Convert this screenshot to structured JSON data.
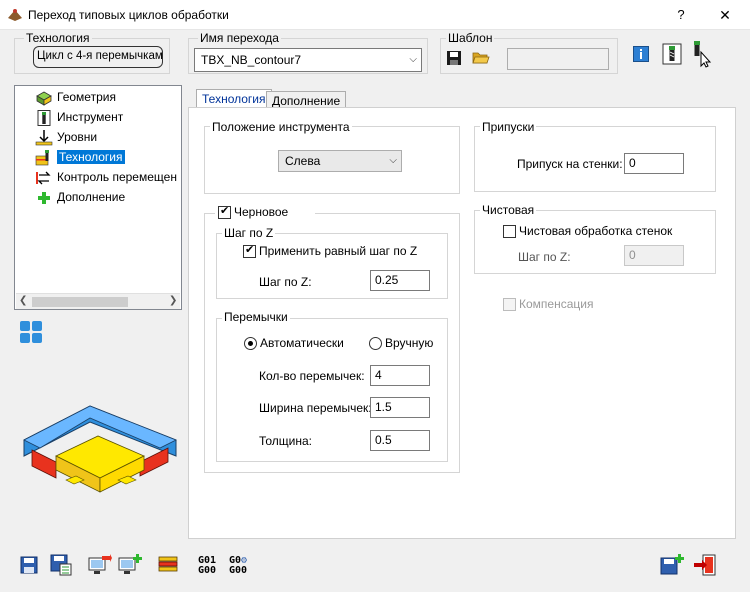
{
  "window": {
    "title": "Переход типовых циклов обработки",
    "help_label": "?",
    "close_label": "✕"
  },
  "header": {
    "technology_label": "Технология",
    "technology_value": "Цикл с 4-я перемычками",
    "transition_name_label": "Имя перехода",
    "transition_name_value": "TBX_NB_contour7",
    "template_label": "Шаблон",
    "template_value": ""
  },
  "tree": {
    "items": [
      {
        "label": "Геометрия",
        "icon": "geometry-icon"
      },
      {
        "label": "Инструмент",
        "icon": "tool-icon"
      },
      {
        "label": "Уровни",
        "icon": "levels-icon"
      },
      {
        "label": "Технология",
        "icon": "technology-icon",
        "selected": true
      },
      {
        "label": "Контроль перемещен",
        "icon": "motion-control-icon"
      },
      {
        "label": "Дополнение",
        "icon": "addition-icon"
      }
    ]
  },
  "tabs": [
    {
      "label": "Технология",
      "active": true
    },
    {
      "label": "Дополнение",
      "active": false
    }
  ],
  "tool_position": {
    "group_label": "Положение инструмента",
    "selected": "Слева"
  },
  "allowances": {
    "group_label": "Припуски",
    "wall_label": "Припуск на стенки:",
    "wall_value": "0"
  },
  "rough": {
    "checkbox_label": "Черновое",
    "checked": true,
    "stepz": {
      "group_label": "Шаг по Z",
      "equal_label": "Применить равный шаг по Z",
      "equal_checked": true,
      "step_label": "Шаг по Z:",
      "step_value": "0.25"
    },
    "tabs": {
      "group_label": "Перемычки",
      "auto_label": "Автоматически",
      "manual_label": "Вручную",
      "mode": "auto",
      "count_label": "Кол-во перемычек:",
      "count_value": "4",
      "width_label": "Ширина перемычек:",
      "width_value": "1.5",
      "thickness_label": "Толщина:",
      "thickness_value": "0.5"
    }
  },
  "finish": {
    "group_label": "Чистовая",
    "wall_finish_label": "Чистовая обработка стенок",
    "wall_finish_checked": false,
    "step_label": "Шаг по Z:",
    "step_value": "0"
  },
  "compensation": {
    "label": "Компенсация",
    "checked": false
  },
  "toolbar": {
    "cmd1": "G01",
    "cmd1b": "G00",
    "cmd2": "G0",
    "cmd2b": "G00"
  },
  "colors": {
    "accent": "#0078d7",
    "tab_active_text": "#003399",
    "illustration_blue": "#2f8fdc",
    "illustration_yellow": "#ffe800",
    "illustration_red": "#e8321e"
  }
}
